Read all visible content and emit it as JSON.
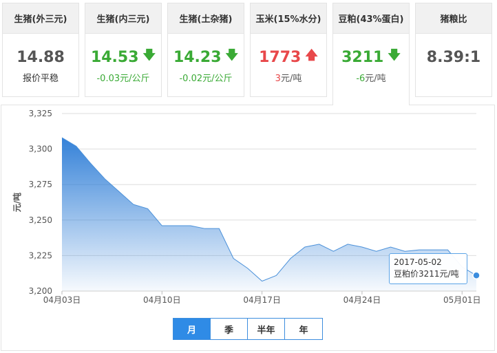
{
  "cards": [
    {
      "title": "生猪(外三元)",
      "value": "14.88",
      "trend": "none",
      "sub_change": "",
      "sub_unit": "报价平稳"
    },
    {
      "title": "生猪(内三元)",
      "value": "14.53",
      "trend": "down",
      "sub_change": "-0.03",
      "sub_unit": "元/公斤"
    },
    {
      "title": "生猪(土杂猪)",
      "value": "14.23",
      "trend": "down",
      "sub_change": "-0.02",
      "sub_unit": "元/公斤"
    },
    {
      "title": "玉米(15%水分)",
      "value": "1773",
      "trend": "up",
      "sub_change": "3",
      "sub_unit": "元/吨"
    },
    {
      "title": "豆粕(43%蛋白)",
      "value": "3211",
      "trend": "down",
      "sub_change": "-6",
      "sub_unit": "元/吨"
    },
    {
      "title": "猪粮比",
      "value": "8.39:1",
      "trend": "none",
      "sub_change": "",
      "sub_unit": ""
    }
  ],
  "colors": {
    "up": "#e8484a",
    "down": "#3aaa35",
    "line": "#4a90d9",
    "area_top": "#2a7bd6",
    "accent": "#2f8be6"
  },
  "icons": {
    "up": "arrow-up-icon",
    "down": "arrow-down-icon"
  },
  "tabs": [
    {
      "label": "月",
      "active": true
    },
    {
      "label": "季",
      "active": false
    },
    {
      "label": "半年",
      "active": false
    },
    {
      "label": "年",
      "active": false
    }
  ],
  "tooltip": {
    "date": "2017-05-02",
    "text": "豆粕价3211元/吨"
  },
  "chart_data": {
    "type": "area",
    "ylabel": "元/吨",
    "ylim": [
      3200,
      3325
    ],
    "yticks": [
      "3,200",
      "3,225",
      "3,250",
      "3,275",
      "3,300",
      "3,325"
    ],
    "ytick_values": [
      3200,
      3225,
      3250,
      3275,
      3300,
      3325
    ],
    "xticks": [
      "04月03日",
      "04月10日",
      "04月17日",
      "04月24日",
      "05月01日"
    ],
    "grid": true,
    "series": [
      {
        "values": [
          3308,
          3302,
          3290,
          3279,
          3270,
          3261,
          3258,
          3246,
          3246,
          3246,
          3244,
          3244,
          3223,
          3216,
          3207,
          3211,
          3223,
          3231,
          3233,
          3228,
          3233,
          3231,
          3228,
          3231,
          3228,
          3229,
          3229,
          3229,
          3217,
          3211
        ]
      }
    ]
  }
}
